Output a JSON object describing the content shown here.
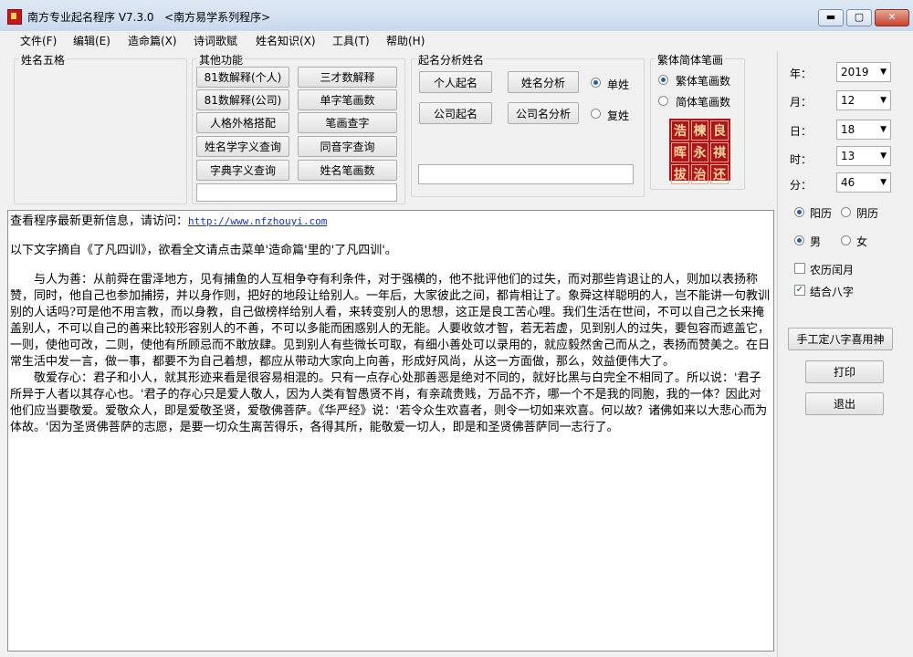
{
  "window": {
    "title": "南方专业起名程序 V7.3.0",
    "subtitle": "<南方易学系列程序>",
    "min_symbol": "▬",
    "max_symbol": "▢",
    "close_symbol": "✕"
  },
  "menu": [
    "文件(F)",
    "编辑(E)",
    "造命篇(X)",
    "诗词歌赋",
    "姓名知识(X)",
    "工具(T)",
    "帮助(H)"
  ],
  "groups": {
    "wuge": "姓名五格",
    "other": "其他功能",
    "analysis": "起名分析姓名",
    "trad": "繁体简体笔画"
  },
  "other_buttons": [
    "81数解释(个人)",
    "三才数解释",
    "81数解释(公司)",
    "单字笔画数",
    "人格外格搭配",
    "笔画查字",
    "姓名学字义查询",
    "同音字查询",
    "字典字义查询",
    "姓名笔画数"
  ],
  "analysis_buttons": [
    "个人起名",
    "姓名分析",
    "公司起名",
    "公司名分析"
  ],
  "surname_type": {
    "single": "单姓",
    "double": "复姓",
    "selected": "single"
  },
  "stroke_mode": {
    "trad": "繁体笔画数",
    "simp": "简体笔画数",
    "selected": "trad"
  },
  "stamp_chars": [
    "浩",
    "楝",
    "良",
    "晖",
    "永",
    "祺",
    "拔",
    "治",
    "还"
  ],
  "date": {
    "year_label": "年：",
    "year": "2019",
    "month_label": "月：",
    "month": "12",
    "day_label": "日：",
    "day": "18",
    "hour_label": "时：",
    "hour": "13",
    "minute_label": "分：",
    "minute": "46"
  },
  "calendar": {
    "solar": "阳历",
    "lunar": "阴历",
    "selected": "solar"
  },
  "gender": {
    "male": "男",
    "female": "女",
    "selected": "male"
  },
  "options": {
    "leap": "农历闰月",
    "leap_checked": false,
    "bazi": "结合八字",
    "bazi_checked": true
  },
  "actions": {
    "bazi_button": "手工定八字喜用神",
    "print": "打印",
    "exit": "退出"
  },
  "content": {
    "line1_prefix": "查看程序最新更新信息，请访问：",
    "url": "http://www.nfzhouyi.com",
    "line2": "以下文字摘自《了凡四训》，欲看全文请点击菜单'造命篇'里的'了凡四训'。",
    "para1": "　　与人为善：从前舜在雷泽地方，见有捕鱼的人互相争夺有利条件，对于强横的，他不批评他们的过失，而对那些肯退让的人，则加以表扬称赞，同时，他自己也参加捕捞，并以身作则，把好的地段让给别人。一年后，大家彼此之间，都肯相让了。象舜这样聪明的人，岂不能讲一句教训别的人话吗?可是他不用言教，而以身教，自己做榜样给别人看，来转变别人的思想，这正是良工苦心哩。我们生活在世间，不可以自己之长来掩盖别人，不可以自己的善来比较形容别人的不善，不可以多能而困惑别人的无能。人要收敛才智，若无若虚，见到别人的过失，要包容而遮盖它，一则，使他可改，二则，使他有所顾忌而不敢放肆。见到别人有些微长可取，有细小善处可以录用的，就应毅然舍己而从之，表扬而赞美之。在日常生活中发一言，做一事，都要不为自己着想，都应从带动大家向上向善，形成好风尚，从这一方面做，那么，效益便伟大了。",
    "para2": "　　敬爱存心：君子和小人，就其形迹来看是很容易相混的。只有一点存心处那善恶是绝对不同的，就好比黑与白完全不相同了。所以说：'君子所异于人者以其存心也。'君子的存心只是爱人敬人，因为人类有智愚贤不肖，有亲疏贵贱，万品不齐，哪一个不是我的同胞，我的一体？因此对他们应当要敬爱。爱敬众人，即是爱敬圣贤，爱敬佛菩萨。《华严经》说：'若令众生欢喜者，则令一切如来欢喜。何以故？诸佛如来以大悲心而为体故。'因为圣贤佛菩萨的志愿，是要一切众生离苦得乐，各得其所，能敬爱一切人，即是和圣贤佛菩萨同一志行了。"
  }
}
